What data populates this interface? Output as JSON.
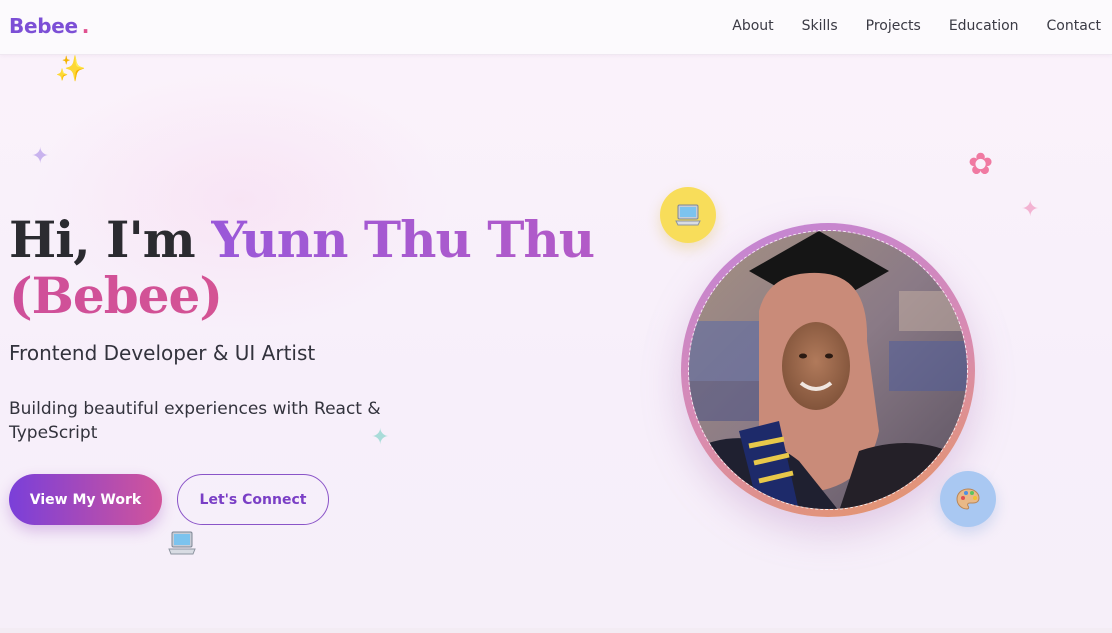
{
  "brand": {
    "name": "Bebee",
    "dot": "."
  },
  "nav": {
    "items": [
      {
        "label": "About"
      },
      {
        "label": "Skills"
      },
      {
        "label": "Projects"
      },
      {
        "label": "Education"
      },
      {
        "label": "Contact"
      }
    ]
  },
  "hero": {
    "greeting": "Hi, I'm",
    "name": "Yunn Thu Thu",
    "nickname": "(Bebee)",
    "subtitle": "Frontend Developer & UI Artist",
    "tagline": "Building beautiful experiences with React & TypeScript",
    "primary_button": "View My Work",
    "secondary_button": "Let's Connect"
  },
  "decorations": {
    "icons": [
      "sparkles-icon",
      "sparkle-icon",
      "flower-icon",
      "laptop-icon",
      "palette-icon"
    ],
    "colors": {
      "accent_purple": "#7c4fd6",
      "accent_pink": "#d2549a",
      "badge_yellow": "#f8dd5a",
      "badge_blue": "#a9c8f2"
    }
  }
}
